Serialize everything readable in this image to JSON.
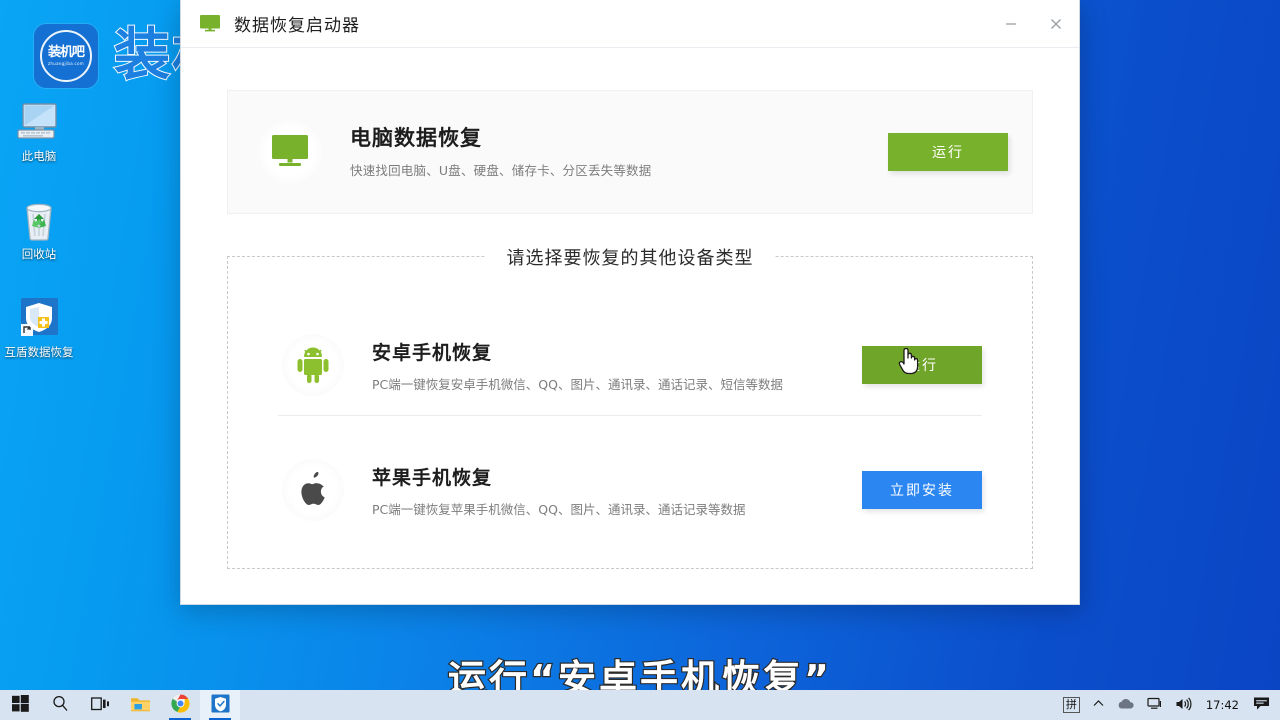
{
  "desktop": {
    "watermark": {
      "badge_cn": "装机吧",
      "badge_en": "zhuangjiba.com",
      "text": "装机吧"
    },
    "icons": [
      {
        "name": "this-pc",
        "label": "此电脑",
        "icon": "monitor-icon"
      },
      {
        "name": "recycle-bin",
        "label": "回收站",
        "icon": "recycle-bin-icon"
      },
      {
        "name": "hudun-recovery",
        "label": "互盾数据恢复",
        "icon": "shield-icon"
      }
    ]
  },
  "window": {
    "title": "数据恢复启动器",
    "title_icon": "monitor-icon",
    "controls": {
      "minimize": "−",
      "close": "×"
    }
  },
  "pc_card": {
    "icon": "monitor-icon",
    "title": "电脑数据恢复",
    "subtitle": "快速找回电脑、U盘、硬盘、储存卡、分区丢失等数据",
    "button": "运行"
  },
  "other_devices": {
    "heading": "请选择要恢复的其他设备类型",
    "rows": [
      {
        "icon": "android-icon",
        "title": "安卓手机恢复",
        "subtitle": "PC端一键恢复安卓手机微信、QQ、图片、通讯录、通话记录、短信等数据",
        "button": "运行",
        "button_style": "green",
        "hovered": true
      },
      {
        "icon": "apple-icon",
        "title": "苹果手机恢复",
        "subtitle": "PC端一键恢复苹果手机微信、QQ、图片、通讯录、通话记录等数据",
        "button": "立即安装",
        "button_style": "blue",
        "hovered": false
      }
    ]
  },
  "caption": "运行“安卓手机恢复”",
  "taskbar": {
    "items": [
      {
        "name": "start-button",
        "icon": "windows-icon"
      },
      {
        "name": "search-button",
        "icon": "search-icon"
      },
      {
        "name": "task-view-button",
        "icon": "task-view-icon"
      },
      {
        "name": "file-explorer-button",
        "icon": "folder-icon"
      },
      {
        "name": "chrome-button",
        "icon": "chrome-icon"
      },
      {
        "name": "recovery-app-button",
        "icon": "shield-icon"
      }
    ],
    "tray": {
      "ime": "拼",
      "chevron": "show-hidden-icons",
      "onedrive": "cloud-icon",
      "network": "network-icon",
      "volume": "volume-icon",
      "clock": "17:42",
      "notifications": "notification-icon"
    }
  },
  "colors": {
    "green": "#78b22c",
    "green_hover": "#6fa528",
    "blue": "#2b86f2",
    "desktop_blue": "#0a8cee",
    "taskbar": "#d7e3f0"
  }
}
